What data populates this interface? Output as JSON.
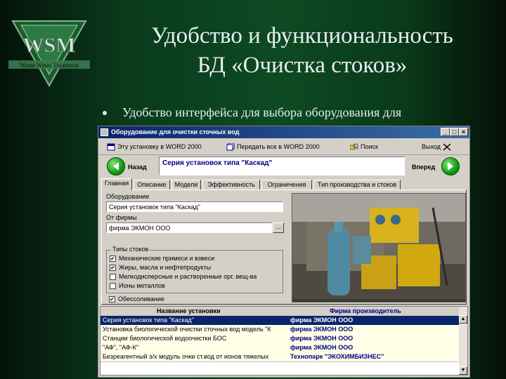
{
  "slide": {
    "title_line1": "Удобство и функциональность",
    "title_line2": "БД «Очистка стоков»",
    "bullet": "Удобство интерфейса для выбора оборудования для",
    "logo": {
      "letters": "WSM",
      "caption": "Waste Water Treatment"
    }
  },
  "window": {
    "title": "Оборудование для очистки сточных вод",
    "controls": [
      "_",
      "□",
      "×"
    ],
    "toolbar": {
      "word_one": "Эту установку в WORD 2000",
      "word_all": "Передать все в WORD 2000",
      "search": "Поиск",
      "exit": "Выход"
    },
    "nav": {
      "back": "Назад",
      "forward": "Вперед",
      "series": "Серия установок типа \"Каскад\""
    },
    "tabs": [
      "Главная",
      "Описание",
      "Модели",
      "Эффективность",
      "Ограничения",
      "Тип производства и стоков"
    ],
    "active_tab": "Главная",
    "main": {
      "equipment_label": "Оборудование",
      "equipment_value": "Серия установок типа \"Каскад\"",
      "firm_label": "От фирмы",
      "firm_value": "фирма ЭКМОН ООО",
      "firm_button": "...",
      "waste_types_label": "Типы стоков",
      "waste_types": [
        {
          "label": "Механические примеси и взвеси",
          "checked": true
        },
        {
          "label": "Жиры, масла и нефтепродукты",
          "checked": true
        },
        {
          "label": "Мелкодисперсные и растворенные орг. вещ-ва",
          "checked": false
        },
        {
          "label": "Ионы металлов",
          "checked": false
        },
        {
          "label": "Обессоливание",
          "checked": true
        }
      ]
    },
    "grid": {
      "headers": [
        "Название установки",
        "Фирма производитель"
      ],
      "rows": [
        {
          "name": "Серия установок типа \"Каскад\"",
          "firm": "фирма ЭКМОН ООО",
          "selected": true
        },
        {
          "name": "Установка биологической очистки сточных вод модель \"К",
          "firm": "фирма ЭКМОН ООО",
          "selected": false
        },
        {
          "name": "Станции биологической водоочистки БОС",
          "firm": "фирма ЭКМОН ООО",
          "selected": false
        },
        {
          "name": "\"АФ\", \"АФ-К\"",
          "firm": "фирма ЭКМОН ООО",
          "selected": false
        },
        {
          "name": "Безреагентный э/х модуль очки ст.вод от ионов тяжелых",
          "firm": "Технопарк \"ЭКОХИМБИЗНЕС\"",
          "selected": false
        }
      ]
    }
  },
  "colors": {
    "title_bar": "#0a246a",
    "selection": "#0a246a",
    "firm_text": "#000080",
    "nav_button": "#119a11"
  }
}
